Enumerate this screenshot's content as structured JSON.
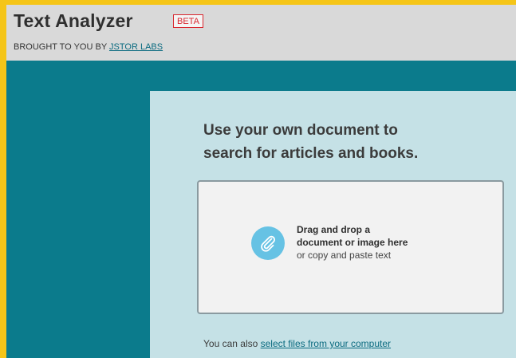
{
  "header": {
    "title": "Text Analyzer",
    "badge": "BETA",
    "byline_prefix": "BROUGHT TO YOU BY ",
    "byline_link": "JSTOR LABS"
  },
  "main": {
    "heading_line1": "Use your own document to",
    "heading_line2": "search for articles and books.",
    "dropzone": {
      "line1": "Drag and drop a",
      "line2": "document or image here",
      "line3": "or copy and paste text",
      "icon": "paperclip-icon"
    },
    "also_prefix": "You can also ",
    "also_link": "select files from your computer"
  },
  "colors": {
    "frame": "#f5c518",
    "teal": "#0b7b8c",
    "panel": "#c5e1e6",
    "badge": "#d9262e",
    "icon_circle": "#66c2e4"
  }
}
